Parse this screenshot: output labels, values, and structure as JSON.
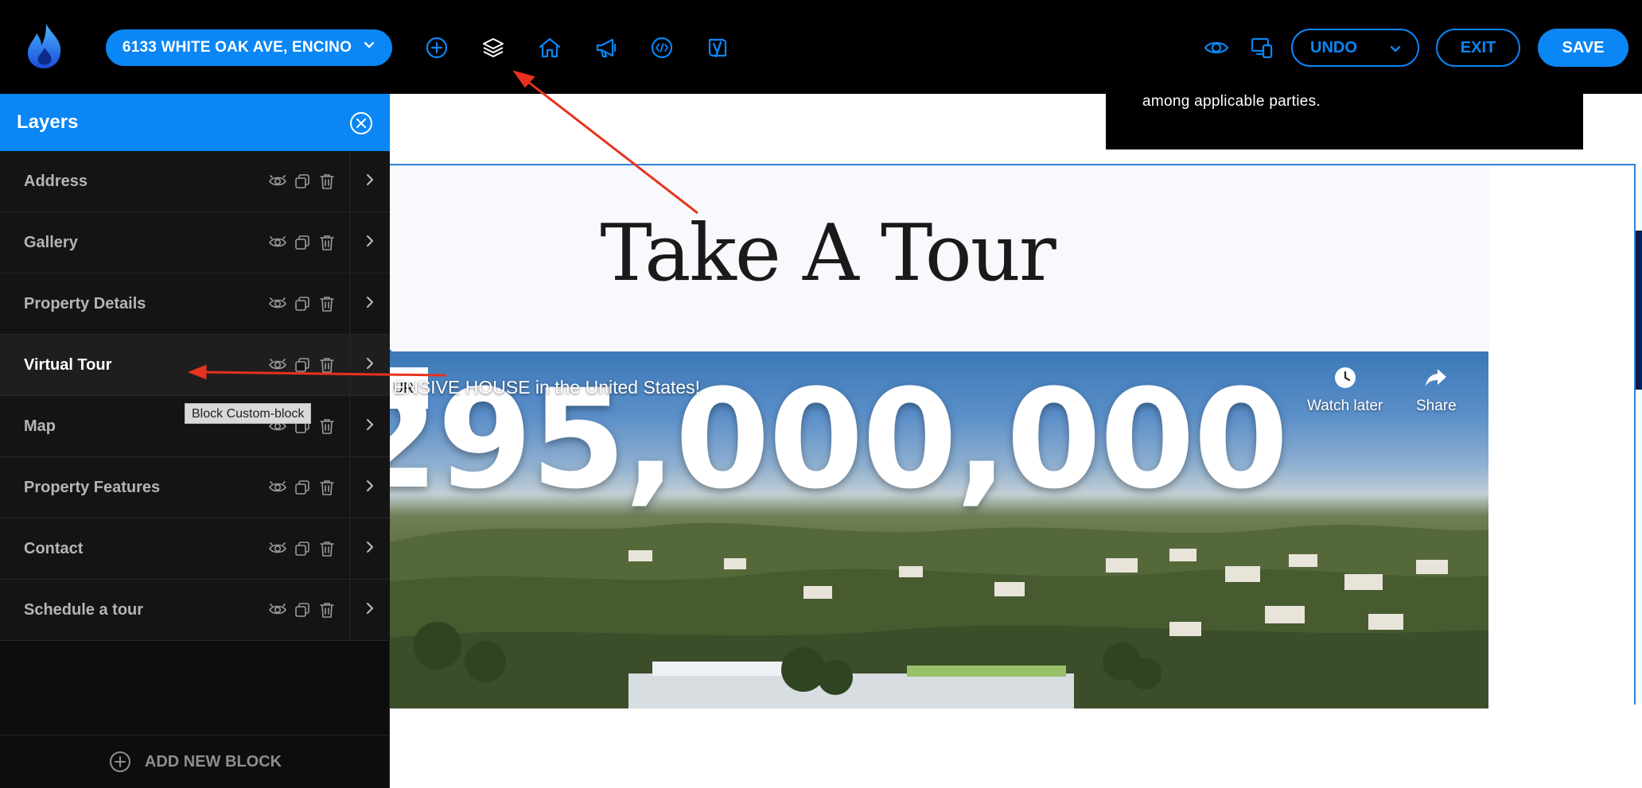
{
  "topbar": {
    "property_button_label": "6133 WHITE OAK AVE, ENCINO",
    "tools": [
      {
        "icon": "plus-circle-icon"
      },
      {
        "icon": "layers-icon"
      },
      {
        "icon": "home-icon"
      },
      {
        "icon": "megaphone-icon"
      },
      {
        "icon": "code-icon"
      },
      {
        "icon": "yoast-icon"
      }
    ],
    "preview_icon": "eye-icon",
    "devices_icon": "devices-icon",
    "undo_label": "UNDO",
    "exit_label": "EXIT",
    "save_label": "SAVE"
  },
  "canvas": {
    "notice_text": "among applicable parties.",
    "section_title": "Take A Tour",
    "video": {
      "title_fragment": "ENSIVE HOUSE in the United States!",
      "pill_text": "UR",
      "price_overlay": "295,000,000",
      "watch_later_label": "Watch later",
      "share_label": "Share"
    }
  },
  "layers": {
    "title": "Layers",
    "items": [
      {
        "label": "Address"
      },
      {
        "label": "Gallery"
      },
      {
        "label": "Property Details"
      },
      {
        "label": "Virtual Tour"
      },
      {
        "label": "Map"
      },
      {
        "label": "Property Features"
      },
      {
        "label": "Contact"
      },
      {
        "label": "Schedule a tour"
      }
    ],
    "active_item": "Virtual Tour",
    "tooltip": "Block Custom-block",
    "add_block_label": "ADD NEW BLOCK"
  },
  "colors": {
    "accent": "#0a86f5",
    "topbar_bg": "#000000",
    "panel_bg": "#141414",
    "annotation": "#e8321e"
  }
}
